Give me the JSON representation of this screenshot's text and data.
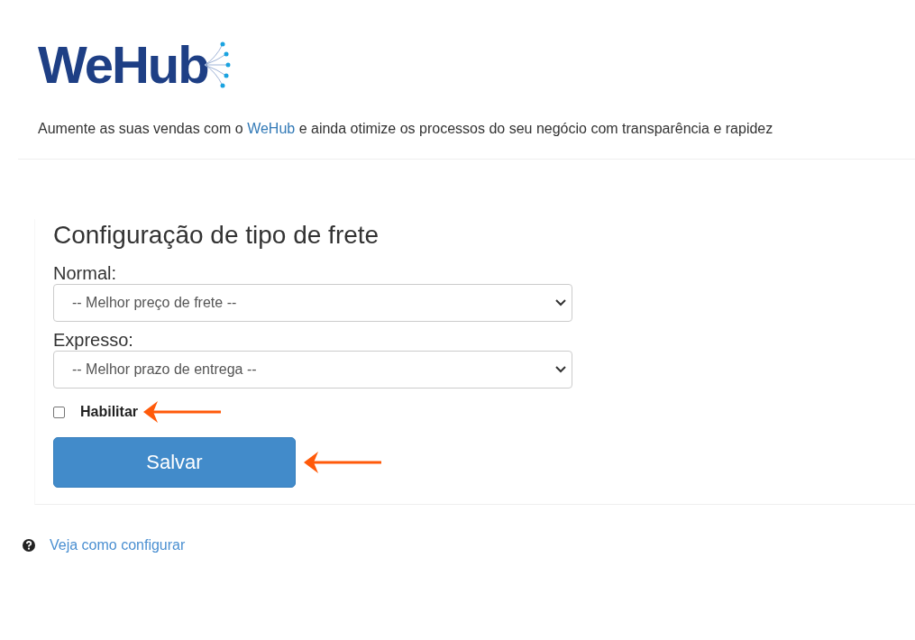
{
  "logo": {
    "text": "WeHub"
  },
  "tagline": {
    "before": "Aumente as suas vendas com o ",
    "link": "WeHub",
    "after": " e ainda otimize os processos do seu negócio com transparência e rapidez"
  },
  "form": {
    "title": "Configuração de tipo de frete",
    "selects": [
      {
        "label": "Normal:",
        "value": "-- Melhor preço de frete --"
      },
      {
        "label": "Expresso:",
        "value": "-- Melhor prazo de entrega --"
      }
    ],
    "enable": {
      "label": "Habilitar",
      "checked": false
    },
    "save_button": "Salvar"
  },
  "help_link": "Veja como configurar"
}
